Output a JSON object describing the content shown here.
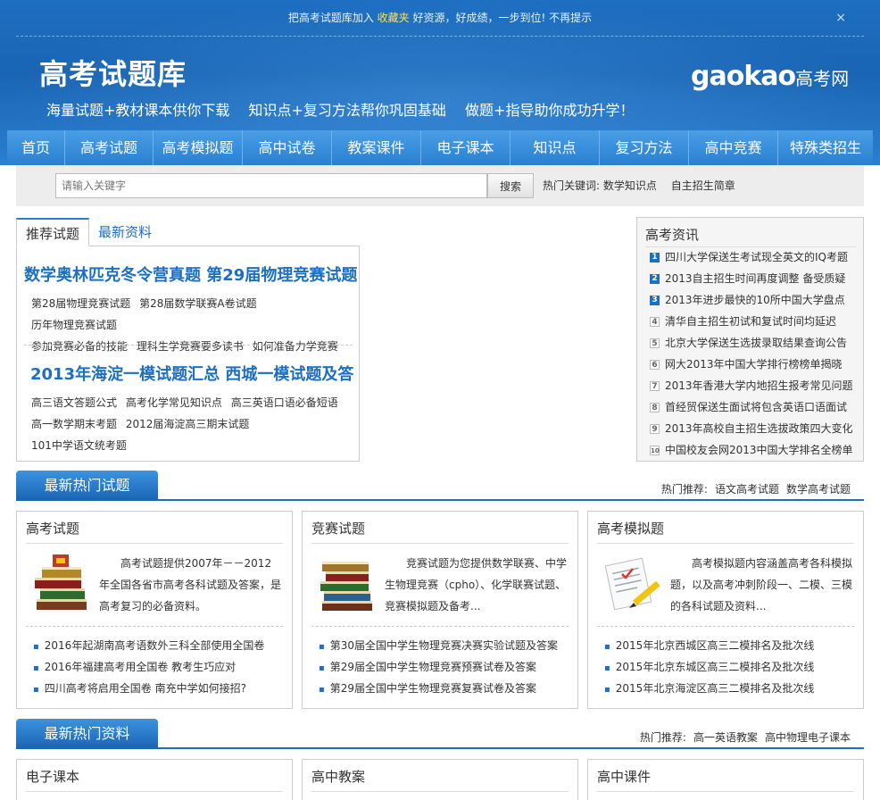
{
  "topbar": {
    "text_before": "把高考试题库加入",
    "favorites": "收藏夹",
    "text_after": "好资源，好成绩，一步到位!",
    "dismiss": "不再提示",
    "close": "×"
  },
  "header": {
    "site_title": "高考试题库",
    "slogan": [
      "海量试题+教材课本供你下载",
      "知识点+复习方法帮你巩固基础",
      "做题+指导助你成功升学！"
    ],
    "logo_en": "gaokao",
    "logo_cn": "高考网"
  },
  "nav": [
    "首页",
    "高考试题",
    "高考模拟题",
    "高中试卷",
    "教案课件",
    "电子课本",
    "知识点",
    "复习方法",
    "高中竞赛",
    "特殊类招生"
  ],
  "search": {
    "placeholder": "请输入关键字",
    "button": "搜索",
    "hot_label": "热门关键词:",
    "hot_words": [
      "数学知识点",
      "自主招生简章"
    ]
  },
  "recommend": {
    "tabs": [
      "推荐试题",
      "最新资料"
    ],
    "headline1": "数学奥林匹克冬令营真题 第29届物理竞赛试题",
    "links1": [
      "第28届物理竞赛试题",
      "第28届数学联赛A卷试题",
      "历年物理竞赛试题",
      "参加竞赛必备的技能",
      "理科生学竞赛要多读书",
      "如何准备力学竞赛"
    ],
    "headline2": "2013年海淀一模试题汇总 西城一模试题及答",
    "links2": [
      "高三语文答题公式",
      "高考化学常见知识点",
      "高三英语口语必备短语",
      "高一数学期末考题",
      "2012届海淀高三期末试题",
      "101中学语文统考题"
    ]
  },
  "news": {
    "title": "高考资讯",
    "items": [
      {
        "num": "1",
        "text": "四川大学保送生考试现全英文的IQ考题"
      },
      {
        "num": "2",
        "text": "2013自主招生时间再度调整 备受质疑"
      },
      {
        "num": "3",
        "text": "2013年进步最快的10所中国大学盘点"
      },
      {
        "num": "4",
        "text": "清华自主招生初试和复试时间均延迟"
      },
      {
        "num": "5",
        "text": "北京大学保送生选拔录取结果查询公告"
      },
      {
        "num": "6",
        "text": "网大2013年中国大学排行榜榜单揭晓"
      },
      {
        "num": "7",
        "text": "2013年香港大学内地招生报考常见问题"
      },
      {
        "num": "8",
        "text": "首经贸保送生面试将包含英语口语面试"
      },
      {
        "num": "9",
        "text": "2013年高校自主招生选拔政策四大变化"
      },
      {
        "num": "10",
        "text": "中国校友会网2013中国大学排名全榜单"
      }
    ]
  },
  "section1": {
    "title": "最新热门试题",
    "hot_label": "热门推荐:",
    "hot_links": [
      "语文高考试题",
      "数学高考试题"
    ],
    "cards": [
      {
        "title": "高考试题",
        "desc": "高考试题提供2007年－－2012年全国各省市高考各科试题及答案，是高考复习的必备资料。",
        "links": [
          "2016年起湖南高考语数外三科全部使用全国卷",
          "2016年福建高考用全国卷 教考生巧应对",
          "四川高考将启用全国卷 南充中学如何接招?"
        ]
      },
      {
        "title": "竞赛试题",
        "desc": "竞赛试题为您提供数学联赛、中学生物理竞赛（cpho）、化学联赛试题、竞赛模拟题及备考...",
        "links": [
          "第30届全国中学生物理竞赛决赛实验试题及答案",
          "第29届全国中学生物理竞赛预赛试卷及答案",
          "第29届全国中学生物理竞赛复赛试卷及答案"
        ]
      },
      {
        "title": "高考模拟题",
        "desc": "高考模拟题内容涵盖高考各科模拟题，以及高考冲刺阶段一、二模、三模的各科试题及资料...",
        "links": [
          "2015年北京西城区高三二模排名及批次线",
          "2015年北京东城区高三二模排名及批次线",
          "2015年北京海淀区高三二模排名及批次线"
        ]
      }
    ]
  },
  "section2": {
    "title": "最新热门资料",
    "hot_label": "热门推荐:",
    "hot_links": [
      "高一英语教案",
      "高中物理电子课本"
    ],
    "cards": [
      {
        "title": "电子课本"
      },
      {
        "title": "高中教案"
      },
      {
        "title": "高中课件"
      }
    ]
  },
  "colors": {
    "brand_blue": "#1d6fc2",
    "accent_yellow": "#ffe14d"
  }
}
